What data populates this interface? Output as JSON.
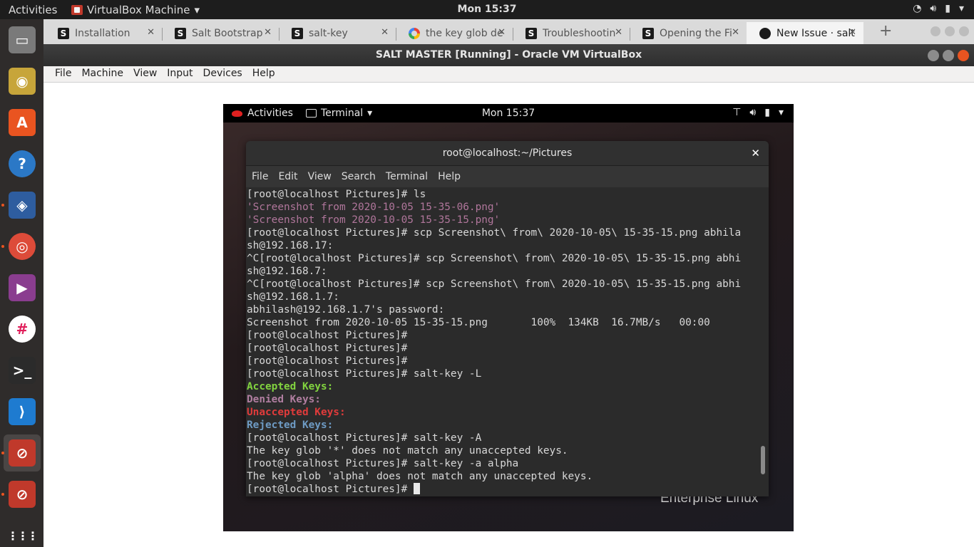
{
  "topbar": {
    "activities": "Activities",
    "app_name": "VirtualBox Machine",
    "clock": "Mon 15:37",
    "tray_icons": [
      "wifi-icon",
      "volume-icon",
      "battery-icon",
      "system-menu-icon"
    ]
  },
  "dock": {
    "items": [
      {
        "name": "files-icon",
        "color": "#7a7a7a"
      },
      {
        "name": "rhythmbox-icon",
        "color": "#c7a53a"
      },
      {
        "name": "software-center-icon",
        "color": "#e95420"
      },
      {
        "name": "help-icon",
        "color": "#2b78c6"
      },
      {
        "name": "virtualbox-icon",
        "color": "#2e5d9f"
      },
      {
        "name": "chrome-icon",
        "color": "#dd4b39"
      },
      {
        "name": "video-player-icon",
        "color": "#8a3d8f"
      },
      {
        "name": "slack-icon",
        "color": "#ffffff"
      },
      {
        "name": "terminal-icon",
        "color": "#2b2b2b"
      },
      {
        "name": "vscode-icon",
        "color": "#1e7bd0"
      },
      {
        "name": "vm-window-icon",
        "color": "#c0392b"
      },
      {
        "name": "vm-window-icon",
        "color": "#c0392b"
      },
      {
        "name": "show-apps-icon",
        "color": "#ffffff"
      }
    ]
  },
  "browser": {
    "tabs": [
      {
        "title": "Installation",
        "favicon": "salt"
      },
      {
        "title": "Salt Bootstrap",
        "favicon": "salt"
      },
      {
        "title": "salt-key",
        "favicon": "salt"
      },
      {
        "title": "the key glob de",
        "favicon": "google"
      },
      {
        "title": "Troubleshootin",
        "favicon": "salt"
      },
      {
        "title": "Opening the Fi",
        "favicon": "salt"
      },
      {
        "title": "New Issue · salt",
        "favicon": "github",
        "active": true
      }
    ],
    "close_glyph": "✕",
    "new_tab_glyph": "+"
  },
  "vbox": {
    "title": "SALT MASTER [Running] - Oracle VM VirtualBox",
    "menu": [
      "File",
      "Machine",
      "View",
      "Input",
      "Devices",
      "Help"
    ]
  },
  "guest": {
    "activities": "Activities",
    "app_name": "Terminal",
    "clock": "Mon 15:37",
    "wallpaper_text": "Enterprise Linux"
  },
  "terminal": {
    "title": "root@localhost:~/Pictures",
    "close_glyph": "✕",
    "menu": [
      "File",
      "Edit",
      "View",
      "Search",
      "Terminal",
      "Help"
    ],
    "scroll_position": 0.92,
    "lines": [
      {
        "text": "[root@localhost Pictures]# ls",
        "style": "normal"
      },
      {
        "text": "'Screenshot from 2020-10-05 15-35-06.png'",
        "style": "magenta"
      },
      {
        "text": "'Screenshot from 2020-10-05 15-35-15.png'",
        "style": "magenta"
      },
      {
        "text": "[root@localhost Pictures]# scp Screenshot\\ from\\ 2020-10-05\\ 15-35-15.png abhila",
        "style": "normal"
      },
      {
        "text": "sh@192.168.17:",
        "style": "normal"
      },
      {
        "text": "^C[root@localhost Pictures]# scp Screenshot\\ from\\ 2020-10-05\\ 15-35-15.png abhi",
        "style": "normal"
      },
      {
        "text": "sh@192.168.7:",
        "style": "normal"
      },
      {
        "text": "^C[root@localhost Pictures]# scp Screenshot\\ from\\ 2020-10-05\\ 15-35-15.png abhi",
        "style": "normal"
      },
      {
        "text": "sh@192.168.1.7:",
        "style": "normal"
      },
      {
        "text": "abhilash@192.168.1.7's password:",
        "style": "normal"
      },
      {
        "text": "Screenshot from 2020-10-05 15-35-15.png       100%  134KB  16.7MB/s   00:00",
        "style": "normal"
      },
      {
        "text": "[root@localhost Pictures]#",
        "style": "normal"
      },
      {
        "text": "[root@localhost Pictures]#",
        "style": "normal"
      },
      {
        "text": "[root@localhost Pictures]#",
        "style": "normal"
      },
      {
        "text": "[root@localhost Pictures]# salt-key -L",
        "style": "normal"
      },
      {
        "text": "Accepted Keys:",
        "style": "green"
      },
      {
        "text": "Denied Keys:",
        "style": "purple"
      },
      {
        "text": "Unaccepted Keys:",
        "style": "red"
      },
      {
        "text": "Rejected Keys:",
        "style": "blue"
      },
      {
        "text": "[root@localhost Pictures]# salt-key -A",
        "style": "normal"
      },
      {
        "text": "The key glob '*' does not match any unaccepted keys.",
        "style": "normal"
      },
      {
        "text": "[root@localhost Pictures]# salt-key -a alpha",
        "style": "normal"
      },
      {
        "text": "The key glob 'alpha' does not match any unaccepted keys.",
        "style": "normal"
      },
      {
        "text": "[root@localhost Pictures]# ",
        "style": "prompt"
      }
    ]
  },
  "colors": {
    "accent": "#e95420",
    "terminal_bg": "#2b2b2b",
    "accepted": "#82d43f",
    "denied": "#b07ea0",
    "unaccepted": "#e03b3b",
    "rejected": "#6e9bc4"
  }
}
